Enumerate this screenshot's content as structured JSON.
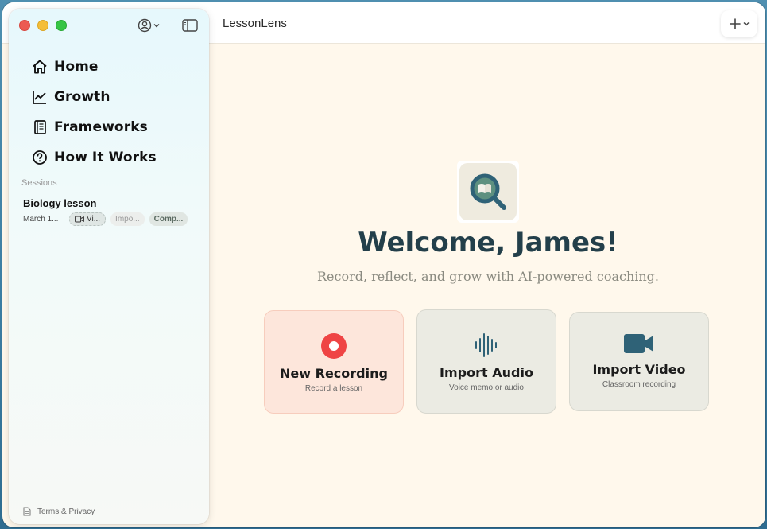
{
  "app": {
    "title": "LessonLens"
  },
  "sidebar": {
    "nav": [
      {
        "label": "Home",
        "icon": "home-icon"
      },
      {
        "label": "Growth",
        "icon": "chart-line-icon"
      },
      {
        "label": "Frameworks",
        "icon": "book-icon"
      },
      {
        "label": "How It Works",
        "icon": "help-circle-icon"
      }
    ],
    "sessions_heading": "Sessions",
    "sessions": [
      {
        "title": "Biology lesson",
        "date": "March 1...",
        "tags": [
          "Vi...",
          "Impo...",
          "Comp..."
        ]
      }
    ],
    "footer": "Terms & Privacy"
  },
  "main": {
    "welcome": "Welcome, James!",
    "subtitle": "Record, reflect, and grow with AI-powered coaching.",
    "cards": [
      {
        "title": "New Recording",
        "subtitle": "Record a lesson",
        "icon": "record-icon"
      },
      {
        "title": "Import Audio",
        "subtitle": "Voice memo or audio",
        "icon": "waveform-icon"
      },
      {
        "title": "Import Video",
        "subtitle": "Classroom recording",
        "icon": "video-camera-icon"
      }
    ]
  },
  "colors": {
    "accent_red": "#ef4444",
    "brand_teal": "#2f6277",
    "background": "#fff8ec"
  }
}
